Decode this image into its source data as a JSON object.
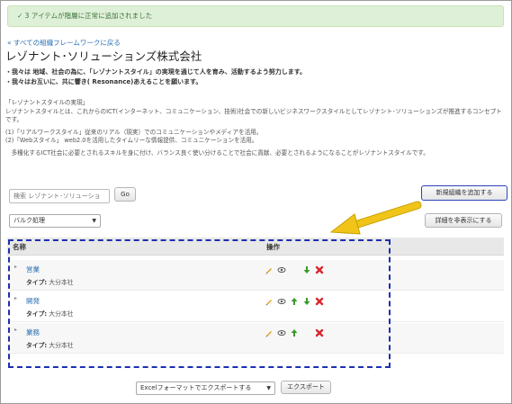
{
  "alert": {
    "message": "✓ 3 アイテムが階層に正常に追加されました"
  },
  "nav": {
    "back_link": "« すべての組織フレームワークに戻る"
  },
  "org": {
    "title": "レゾナント･ソリューションズ株式会社",
    "mission": [
      "・我々は 地域、社会の為に、「レゾナントスタイル」の実現を通じて人を育み、活動するよう努力します。",
      "・我々はお互いに、共に響き( Resonance)あえることを願います。"
    ],
    "description": [
      "「レゾナントスタイルの実現」",
      "レゾナントスタイルとは、これからのICT(インターネット、コミュニケーション、技術)社会での新しいビジネスワークスタイルとしてレゾナント･ソリューションズが推進するコンセプトです。",
      "(1)「リアルワークスタイル」従来のリアル（現実）でのコミュニケーションやメディアを活用。",
      "(2)「Webスタイル」 web2.0を活用したタイムリーな情報提供、コミュニケーションを活用。",
      "　多種化するICT社会に必要とされるスキルを身に付け、バランス良く使い分けることで社会に貢献、必要とされるようになることがレゾナントスタイルです。"
    ]
  },
  "search": {
    "placeholder": "検索 レゾナント･ソリューショ",
    "go_label": "Go"
  },
  "toolbar": {
    "add_label": "新規組織を追加する",
    "toggle_details_label": "詳細を非表示にする",
    "bulk_select_value": "バルク処理"
  },
  "table": {
    "headers": {
      "name": "名称",
      "operations": "操作"
    },
    "type_label": "タイプ:",
    "rows": [
      {
        "name": "営業",
        "type": "大分本社",
        "ops": [
          "edit-icon",
          "view-icon",
          "move-down-icon",
          "delete-icon"
        ]
      },
      {
        "name": "開発",
        "type": "大分本社",
        "ops": [
          "edit-icon",
          "view-icon",
          "move-up-icon",
          "move-down-icon",
          "delete-icon"
        ]
      },
      {
        "name": "業務",
        "type": "大分本社",
        "ops": [
          "edit-icon",
          "view-icon",
          "move-up-icon",
          "delete-icon"
        ]
      }
    ]
  },
  "export": {
    "format_value": "Excelフォーマットでエクスポートする",
    "button_label": "エクスポート"
  },
  "colors": {
    "accent_link": "#2a6fb3",
    "alert_bg": "#dff0d8",
    "annotation_box": "#1c2fb0",
    "annotation_arrow": "#f0c419",
    "edit": "#e0a020",
    "move": "#3a9a2a",
    "delete": "#d9262c"
  }
}
